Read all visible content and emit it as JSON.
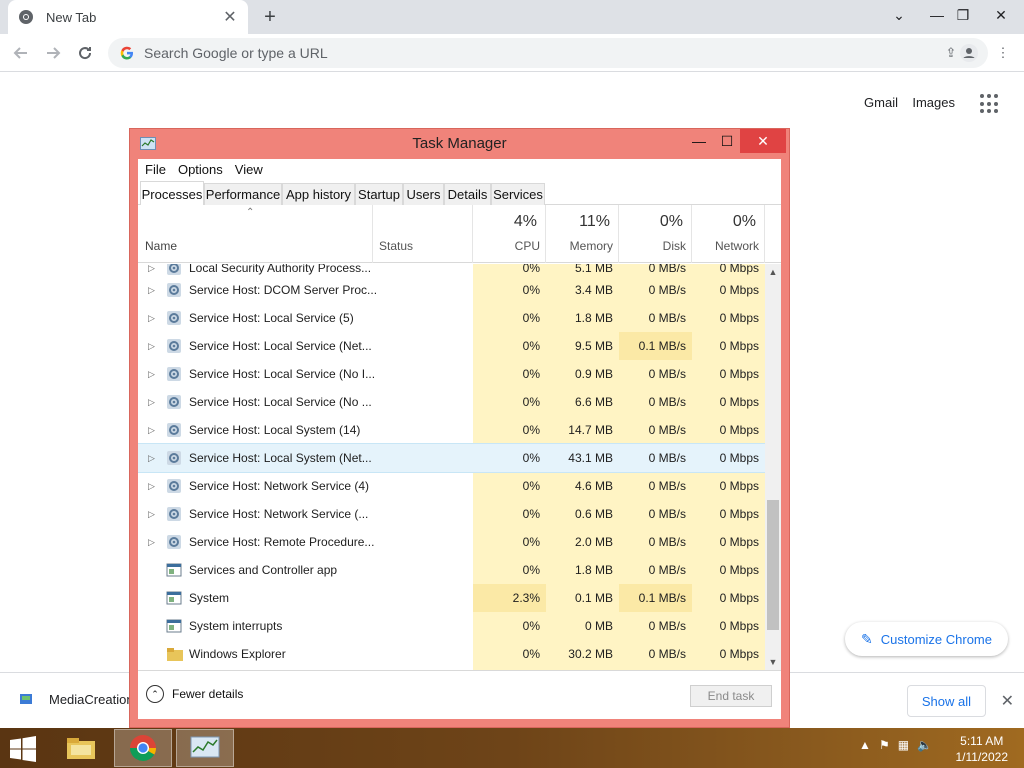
{
  "chrome": {
    "tab_title": "New Tab",
    "omnibox_placeholder": "Search Google or type a URL",
    "gmail": "Gmail",
    "images": "Images",
    "customize": "Customize Chrome",
    "download_name": "MediaCreation",
    "show_all": "Show all"
  },
  "taskmgr": {
    "title": "Task Manager",
    "menu": [
      "File",
      "Options",
      "View"
    ],
    "tabs": [
      "Processes",
      "Performance",
      "App history",
      "Startup",
      "Users",
      "Details",
      "Services"
    ],
    "columns": {
      "name": "Name",
      "status": "Status",
      "cpu": {
        "pct": "4%",
        "label": "CPU"
      },
      "memory": {
        "pct": "11%",
        "label": "Memory"
      },
      "disk": {
        "pct": "0%",
        "label": "Disk"
      },
      "network": {
        "pct": "0%",
        "label": "Network"
      }
    },
    "partial_row": {
      "name": "Local Security Authority Process...",
      "cpu": "0%",
      "mem": "5.1 MB",
      "disk": "0 MB/s",
      "net": "0 Mbps"
    },
    "rows": [
      {
        "name": "Service Host: DCOM Server Proc...",
        "cpu": "0%",
        "mem": "3.4 MB",
        "disk": "0 MB/s",
        "net": "0 Mbps",
        "expandable": true,
        "icon": "gear-icon"
      },
      {
        "name": "Service Host: Local Service (5)",
        "cpu": "0%",
        "mem": "1.8 MB",
        "disk": "0 MB/s",
        "net": "0 Mbps",
        "expandable": true,
        "icon": "gear-icon"
      },
      {
        "name": "Service Host: Local Service (Net...",
        "cpu": "0%",
        "mem": "9.5 MB",
        "disk": "0.1 MB/s",
        "net": "0 Mbps",
        "expandable": true,
        "icon": "gear-icon"
      },
      {
        "name": "Service Host: Local Service (No I...",
        "cpu": "0%",
        "mem": "0.9 MB",
        "disk": "0 MB/s",
        "net": "0 Mbps",
        "expandable": true,
        "icon": "gear-icon"
      },
      {
        "name": "Service Host: Local Service (No ...",
        "cpu": "0%",
        "mem": "6.6 MB",
        "disk": "0 MB/s",
        "net": "0 Mbps",
        "expandable": true,
        "icon": "gear-icon"
      },
      {
        "name": "Service Host: Local System (14)",
        "cpu": "0%",
        "mem": "14.7 MB",
        "disk": "0 MB/s",
        "net": "0 Mbps",
        "expandable": true,
        "icon": "gear-icon"
      },
      {
        "name": "Service Host: Local System (Net...",
        "cpu": "0%",
        "mem": "43.1 MB",
        "disk": "0 MB/s",
        "net": "0 Mbps",
        "expandable": true,
        "icon": "gear-icon",
        "selected": true
      },
      {
        "name": "Service Host: Network Service (4)",
        "cpu": "0%",
        "mem": "4.6 MB",
        "disk": "0 MB/s",
        "net": "0 Mbps",
        "expandable": true,
        "icon": "gear-icon"
      },
      {
        "name": "Service Host: Network Service (...",
        "cpu": "0%",
        "mem": "0.6 MB",
        "disk": "0 MB/s",
        "net": "0 Mbps",
        "expandable": true,
        "icon": "gear-icon"
      },
      {
        "name": "Service Host: Remote Procedure...",
        "cpu": "0%",
        "mem": "2.0 MB",
        "disk": "0 MB/s",
        "net": "0 Mbps",
        "expandable": true,
        "icon": "gear-icon"
      },
      {
        "name": "Services and Controller app",
        "cpu": "0%",
        "mem": "1.8 MB",
        "disk": "0 MB/s",
        "net": "0 Mbps",
        "expandable": false,
        "icon": "window-icon"
      },
      {
        "name": "System",
        "cpu": "2.3%",
        "mem": "0.1 MB",
        "disk": "0.1 MB/s",
        "net": "0 Mbps",
        "expandable": false,
        "icon": "window-icon"
      },
      {
        "name": "System interrupts",
        "cpu": "0%",
        "mem": "0 MB",
        "disk": "0 MB/s",
        "net": "0 Mbps",
        "expandable": false,
        "icon": "window-icon"
      },
      {
        "name": "Windows Explorer",
        "cpu": "0%",
        "mem": "30.2 MB",
        "disk": "0 MB/s",
        "net": "0 Mbps",
        "expandable": false,
        "icon": "folder-icon"
      }
    ],
    "fewer_details": "Fewer details",
    "end_task": "End task"
  },
  "taskbar": {
    "time": "5:11 AM",
    "date": "1/11/2022"
  },
  "colors": {
    "tm_frame": "#f0837a",
    "heat_light": "#fff4c4",
    "heat_medium": "#fbe9a6",
    "selected_row": "#e5f3fb",
    "chrome_accent": "#1a73e8"
  }
}
